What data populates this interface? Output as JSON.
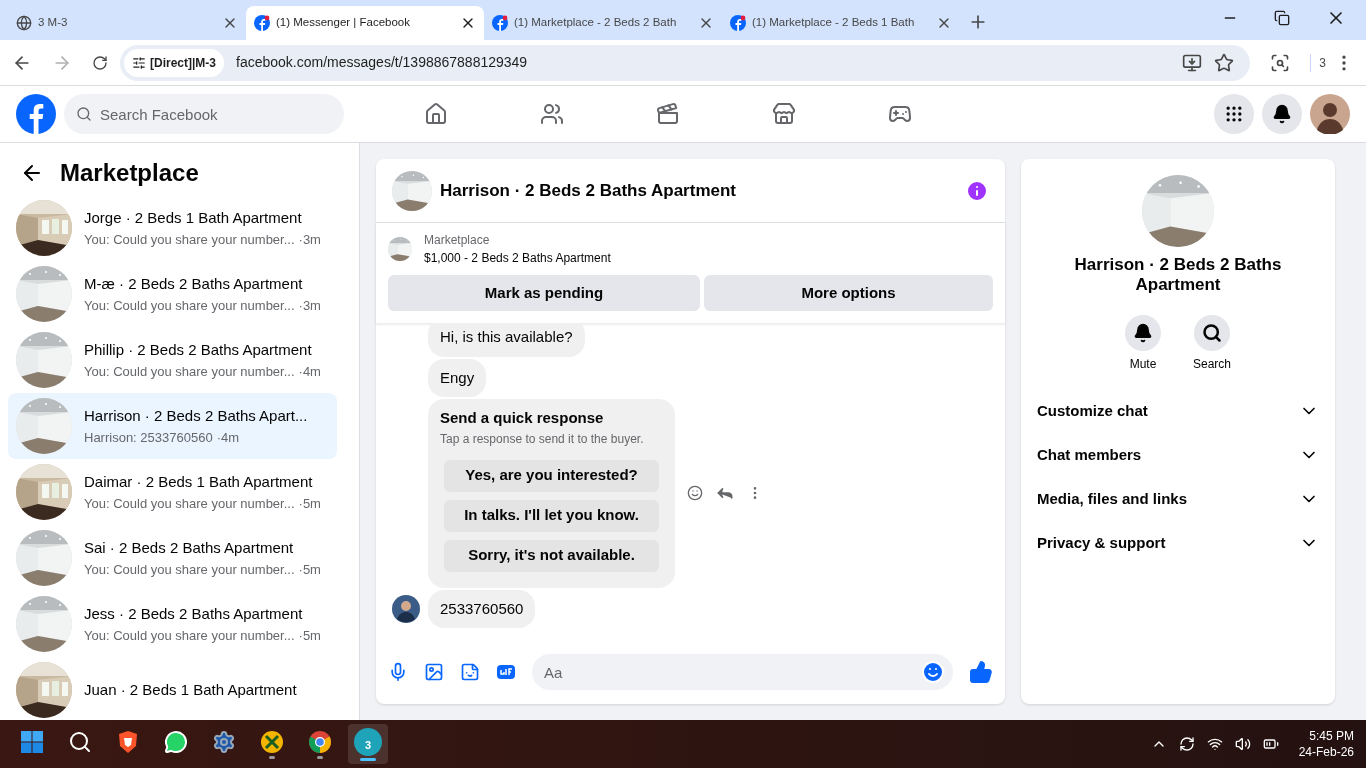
{
  "browser": {
    "tabs": [
      {
        "title": "3 M-3",
        "kind": "globe",
        "selected": false
      },
      {
        "title": "(1) Messenger | Facebook",
        "kind": "facebook",
        "selected": true
      },
      {
        "title": "(1) Marketplace - 2 Beds 2 Bath",
        "kind": "facebook",
        "selected": false
      },
      {
        "title": "(1) Marketplace - 2 Beds 1 Bath",
        "kind": "facebook",
        "selected": false
      }
    ],
    "site_chip": "[Direct]|M-3",
    "url": "facebook.com/messages/t/1398867888129349",
    "profile_count": "3"
  },
  "facebook_header": {
    "search_placeholder": "Search Facebook"
  },
  "sidebar": {
    "title": "Marketplace",
    "conversations": [
      {
        "name": "Jorge · 2 Beds 1 Bath Apartment",
        "snippet": "You: Could you share your number...",
        "time": "·3m",
        "kind": "wood",
        "selected": false
      },
      {
        "name": "M-æ · 2 Beds 2 Baths Apartment",
        "snippet": "You: Could you share your number...",
        "time": "·3m",
        "kind": "white",
        "selected": false
      },
      {
        "name": "Phillip · 2 Beds 2 Baths Apartment",
        "snippet": "You: Could you share your number...",
        "time": "·4m",
        "kind": "white",
        "selected": false
      },
      {
        "name": "Harrison · 2 Beds 2 Baths Apart...",
        "snippet": "Harrison: 2533760560",
        "time": "·4m",
        "kind": "white",
        "selected": true
      },
      {
        "name": "Daimar · 2 Beds 1 Bath Apartment",
        "snippet": "You: Could you share your number...",
        "time": "·5m",
        "kind": "wood",
        "selected": false
      },
      {
        "name": "Sai · 2 Beds 2 Baths Apartment",
        "snippet": "You: Could you share your number...",
        "time": "·5m",
        "kind": "white",
        "selected": false
      },
      {
        "name": "Jess · 2 Beds 2 Baths Apartment",
        "snippet": "You: Could you share your number...",
        "time": "·5m",
        "kind": "white",
        "selected": false
      },
      {
        "name": "Juan · 2 Beds 1 Bath Apartment",
        "kind": "wood",
        "selected": false
      }
    ]
  },
  "chat": {
    "title": "Harrison · 2 Beds 2 Baths Apartment",
    "listing": {
      "label": "Marketplace",
      "title": "$1,000 - 2 Beds 2 Baths Apartment"
    },
    "buttons": [
      "Mark as pending",
      "More options"
    ],
    "messages": [
      {
        "kind": "bubble",
        "text": "Hi, is this available?"
      },
      {
        "kind": "bubble",
        "text": "Engy"
      },
      {
        "kind": "quick_response",
        "title": "Send a quick response",
        "hint": "Tap a response to send it to the buyer.",
        "options": [
          "Yes, are you interested?",
          "In talks. I'll let you know.",
          "Sorry, it's not available."
        ]
      },
      {
        "kind": "incoming",
        "text": "2533760560"
      }
    ],
    "composer_placeholder": "Aa"
  },
  "details": {
    "title": "Harrison · 2 Beds 2 Baths Apartment",
    "actions": [
      {
        "kind": "bell",
        "label": "Mute"
      },
      {
        "kind": "search",
        "label": "Search"
      }
    ],
    "sections": [
      {
        "label": "Customize chat",
        "expanded": false
      },
      {
        "label": "Chat members",
        "expanded": false
      },
      {
        "label": "Media, files and links",
        "expanded": false
      },
      {
        "label": "Privacy & support",
        "expanded": false
      }
    ]
  },
  "taskbar": {
    "apps": [
      {
        "kind": "start",
        "running": false,
        "selected": false
      },
      {
        "kind": "search",
        "running": false,
        "selected": false
      },
      {
        "kind": "lion",
        "running": false,
        "selected": false
      },
      {
        "kind": "chat",
        "running": false,
        "selected": false
      },
      {
        "kind": "gear",
        "running": false,
        "selected": false
      },
      {
        "kind": "cross",
        "running": true,
        "selected": false
      },
      {
        "kind": "browser",
        "running": true,
        "selected": false
      },
      {
        "kind": "badge",
        "label": "3",
        "running": true,
        "selected": true
      }
    ],
    "time": "5:45 PM",
    "date": "24-Feb-26"
  }
}
